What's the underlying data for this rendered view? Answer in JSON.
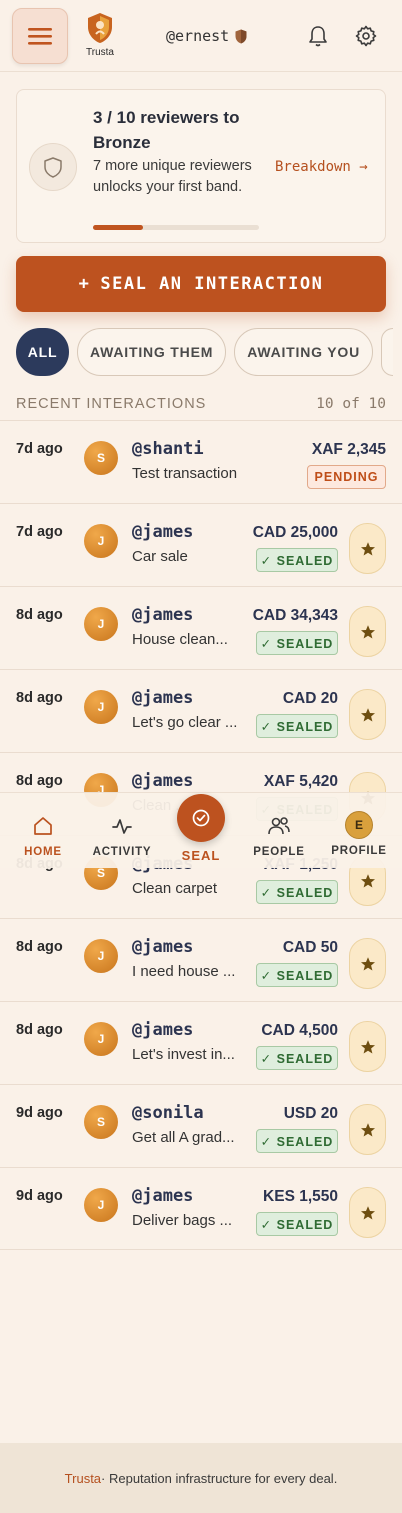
{
  "header": {
    "logo_text": "Trusta",
    "username": "@ernest"
  },
  "progress_card": {
    "title": "3 / 10 reviewers to Bronze",
    "description": "7 more unique reviewers unlocks your first band.",
    "breakdown_link": "Breakdown →",
    "progress_fraction": 0.3
  },
  "seal_button": {
    "icon": "+",
    "label": "SEAL AN INTERACTION"
  },
  "tabs": [
    "ALL",
    "AWAITING THEM",
    "AWAITING YOU"
  ],
  "section": {
    "label": "RECENT INTERACTIONS",
    "count": "10 of 10"
  },
  "interactions": [
    {
      "when": "7d ago",
      "initial": "S",
      "handle": "@shanti",
      "note": "Test transaction",
      "amount": "XAF 2,345",
      "status": "PENDING",
      "status_type": "pending"
    },
    {
      "when": "7d ago",
      "initial": "J",
      "handle": "@james",
      "note": "Car sale",
      "amount": "CAD 25,000",
      "status": "✓ SEALED",
      "status_type": "sealed"
    },
    {
      "when": "8d ago",
      "initial": "J",
      "handle": "@james",
      "note": "House clean...",
      "amount": "CAD 34,343",
      "status": "✓ SEALED",
      "status_type": "sealed"
    },
    {
      "when": "8d ago",
      "initial": "J",
      "handle": "@james",
      "note": "Let's go clear ...",
      "amount": "CAD 20",
      "status": "✓ SEALED",
      "status_type": "sealed"
    },
    {
      "when": "8d ago",
      "initial": "J",
      "handle": "@james",
      "note": "Clean ...",
      "amount": "XAF 5,420",
      "status": "✓ SEALED",
      "status_type": "sealed"
    },
    {
      "when": "8d ago",
      "initial": "S",
      "handle": "@james",
      "note": "Clean carpet",
      "amount": "XAF 1,250",
      "status": "✓ SEALED",
      "status_type": "sealed"
    },
    {
      "when": "8d ago",
      "initial": "J",
      "handle": "@james",
      "note": "I need house ...",
      "amount": "CAD 50",
      "status": "✓ SEALED",
      "status_type": "sealed"
    },
    {
      "when": "8d ago",
      "initial": "J",
      "handle": "@james",
      "note": "Let's invest in...",
      "amount": "CAD 4,500",
      "status": "✓ SEALED",
      "status_type": "sealed"
    },
    {
      "when": "9d ago",
      "initial": "S",
      "handle": "@sonila",
      "note": "Get all A grad...",
      "amount": "USD 20",
      "status": "✓ SEALED",
      "status_type": "sealed"
    },
    {
      "when": "9d ago",
      "initial": "J",
      "handle": "@james",
      "note": "Deliver bags ...",
      "amount": "KES 1,550",
      "status": "✓ SEALED",
      "status_type": "sealed"
    }
  ],
  "bottom_nav": {
    "home": "HOME",
    "activity": "ACTIVITY",
    "seal": "SEAL",
    "people": "PEOPLE",
    "profile": "PROFILE",
    "profile_initial": "E"
  },
  "footer": {
    "brand": "Trusta",
    "tagline": " · Reputation infrastructure for every deal."
  },
  "colors": {
    "accent": "#bd521f",
    "navy": "#2c3a5c",
    "background": "#faf1e8"
  }
}
